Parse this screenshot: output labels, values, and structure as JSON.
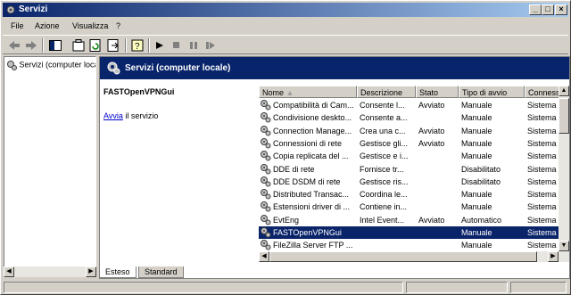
{
  "window": {
    "title": "Servizi"
  },
  "menu": [
    "File",
    "Azione",
    "Visualizza",
    "?"
  ],
  "tree": {
    "item": "Servizi (computer locale)"
  },
  "header": {
    "title": "Servizi (computer locale)"
  },
  "description": {
    "service_name": "FASTOpenVPNGui",
    "action_link": "Avvia",
    "action_text": " il servizio"
  },
  "columns": [
    "Nome",
    "Descrizione",
    "Stato",
    "Tipo di avvio",
    "Connessione"
  ],
  "rows": [
    {
      "name": "Compatibilità di Cam...",
      "desc": "Consente l...",
      "state": "Avviato",
      "start": "Manuale",
      "conn": "Sistema"
    },
    {
      "name": "Condivisione deskto...",
      "desc": "Consente a...",
      "state": "",
      "start": "Manuale",
      "conn": "Sistema"
    },
    {
      "name": "Connection Manage...",
      "desc": "Crea una c...",
      "state": "Avviato",
      "start": "Manuale",
      "conn": "Sistema"
    },
    {
      "name": "Connessioni di rete",
      "desc": "Gestisce gli...",
      "state": "Avviato",
      "start": "Manuale",
      "conn": "Sistema"
    },
    {
      "name": "Copia replicata del ...",
      "desc": "Gestisce e i...",
      "state": "",
      "start": "Manuale",
      "conn": "Sistema"
    },
    {
      "name": "DDE di rete",
      "desc": "Fornisce tr...",
      "state": "",
      "start": "Disabilitato",
      "conn": "Sistema"
    },
    {
      "name": "DDE DSDM di rete",
      "desc": "Gestisce ris...",
      "state": "",
      "start": "Disabilitato",
      "conn": "Sistema"
    },
    {
      "name": "Distributed Transac...",
      "desc": "Coordina le...",
      "state": "",
      "start": "Manuale",
      "conn": "Sistema"
    },
    {
      "name": "Estensioni driver di ...",
      "desc": "Contiene in...",
      "state": "",
      "start": "Manuale",
      "conn": "Sistema"
    },
    {
      "name": "EvtEng",
      "desc": "Intel Event...",
      "state": "Avviato",
      "start": "Automatico",
      "conn": "Sistema"
    },
    {
      "name": "FASTOpenVPNGui",
      "desc": "",
      "state": "",
      "start": "Manuale",
      "conn": "Sistema"
    },
    {
      "name": "FileZilla Server FTP ...",
      "desc": "",
      "state": "",
      "start": "Manuale",
      "conn": "Sistema"
    }
  ],
  "selected_index": 10,
  "tabs": [
    "Esteso",
    "Standard"
  ],
  "colors": {
    "title_start": "#0a246a",
    "title_end": "#a6caf0",
    "selection": "#0a246a"
  }
}
